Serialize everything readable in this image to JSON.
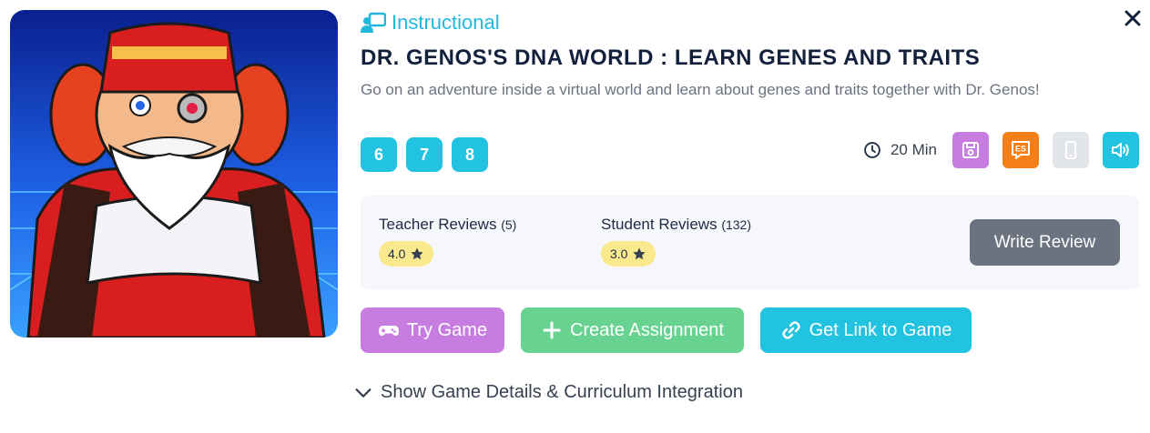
{
  "game": {
    "category": "Instructional",
    "title": "DR. GENOS'S DNA WORLD : LEARN GENES AND TRAITS",
    "description": "Go on an adventure inside a virtual world and learn about genes and traits together with Dr. Genos!",
    "grades": [
      "6",
      "7",
      "8"
    ],
    "duration": "20 Min",
    "language_badge": "ES"
  },
  "reviews": {
    "teacher": {
      "label": "Teacher Reviews",
      "count": "(5)",
      "rating": "4.0"
    },
    "student": {
      "label": "Student Reviews",
      "count": "(132)",
      "rating": "3.0"
    },
    "write_label": "Write Review"
  },
  "actions": {
    "try_label": "Try Game",
    "assign_label": "Create Assignment",
    "link_label": "Get Link to Game"
  },
  "details_toggle": "Show Game Details & Curriculum Integration",
  "colors": {
    "accent_cyan": "#22c3e0",
    "save_purple": "#c77de0",
    "spanish_orange": "#f57f17",
    "mobile_gray": "#e2e6ea",
    "audio_cyan": "#22c3e0",
    "try_purple": "#c77de0",
    "assign_green": "#68d391",
    "link_cyan": "#22c3e0",
    "rating_yellow": "#fbe98e",
    "write_gray": "#6b7280"
  },
  "icons": [
    "presenter-icon",
    "close-icon",
    "clock-icon",
    "save-icon",
    "spanish-icon",
    "mobile-icon",
    "audio-icon",
    "star-icon",
    "gamepad-icon",
    "plus-icon",
    "link-icon",
    "chevron-down-icon"
  ]
}
